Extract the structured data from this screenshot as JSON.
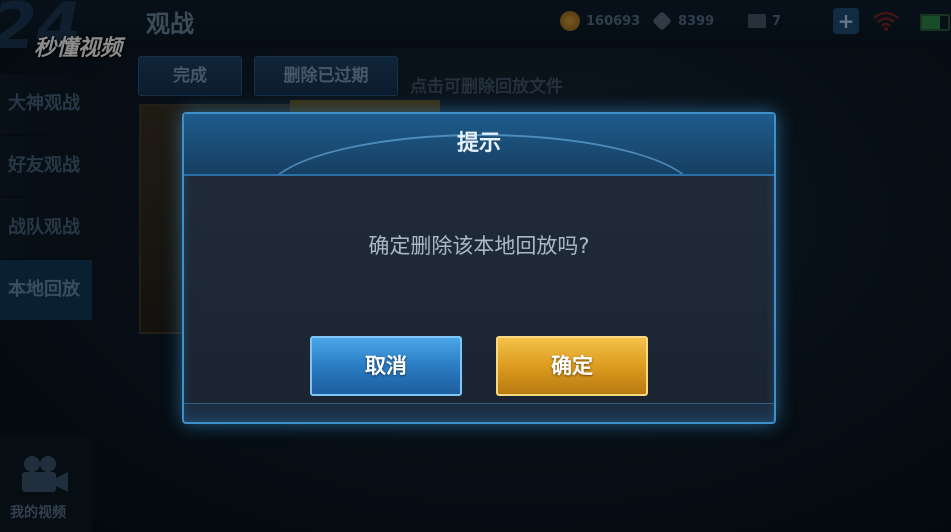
{
  "header": {
    "title": "观战",
    "gold": "160693",
    "diamonds": "8399",
    "tickets": "7",
    "plus": "+"
  },
  "watermark": {
    "text": "秒懂视频"
  },
  "sidebar": {
    "items": [
      {
        "label": "大神观战"
      },
      {
        "label": "好友观战"
      },
      {
        "label": "战队观战"
      },
      {
        "label": "本地回放"
      }
    ],
    "video_label": "我的视频"
  },
  "toolbar": {
    "done_label": "完成",
    "delete_expired_label": "删除已过期",
    "hint": "点击可删除回放文件"
  },
  "modal": {
    "title": "提示",
    "message": "确定删除该本地回放吗?",
    "cancel_label": "取消",
    "confirm_label": "确定"
  },
  "colors": {
    "accent_blue": "#3f8fc9",
    "confirm_gold": "#dc9c1f",
    "cancel_blue": "#2b7cc3"
  }
}
